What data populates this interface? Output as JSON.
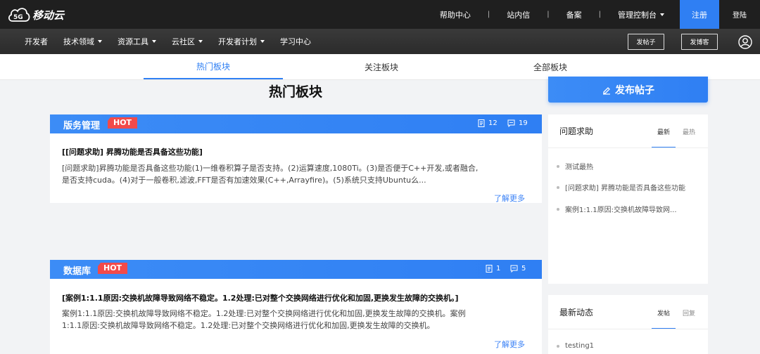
{
  "brand": {
    "logo_text": "移动云",
    "logo_badge": "5G"
  },
  "topnav": {
    "items": [
      "帮助中心",
      "站内信",
      "备案",
      "管理控制台"
    ],
    "separators": [
      "|",
      "|",
      "|"
    ],
    "register": "注册",
    "login": "登陆"
  },
  "secnav": {
    "links": [
      "开发者",
      "技术领域",
      "资源工具",
      "云社区",
      "开发者计划",
      "学习中心"
    ],
    "post_button": "发帖子",
    "blog_button": "发博客"
  },
  "tabs": [
    "热门板块",
    "关注板块",
    "全部板块"
  ],
  "page_title": "热门板块",
  "boards": [
    {
      "name": "版务管理",
      "badge": "HOT",
      "posts_count": "12",
      "comments_count": "19",
      "post_title": "[[问题求助] 昇腾功能是否具备这些功能]",
      "post_desc": "[问题求助]昇腾功能是否具备这些功能(1)一维卷积算子是否支持。(2)运算速度,1080Ti。(3)是否便于C++开发,或者融合,是否支持cuda。(4)对于一般卷积,滤波,FFT是否有加速效果(C++,Arrayfire)。(5)系统只支持Ubuntu么...",
      "more": "了解更多"
    },
    {
      "name": "数据库",
      "badge": "HOT",
      "posts_count": "1",
      "comments_count": "5",
      "post_title": "[案例1:1.1原因:交换机故障导致网络不稳定。1.2处理:已对整个交换网络进行优化和加固,更换发生故障的交换机。]",
      "post_desc": "案例1:1.1原因:交换机故障导致网络不稳定。1.2处理:已对整个交换网络进行优化和加固,更换发生故障的交换机。案例1:1.1原因:交换机故障导致网络不稳定。1.2处理:已对整个交换网络进行优化和加固,更换发生故障的交换机。",
      "more": "了解更多"
    }
  ],
  "sidebar": {
    "publish_label": "发布帖子",
    "help_panel": {
      "title": "问题求助",
      "tab_latest": "最新",
      "tab_hot": "最热",
      "items": [
        "测试最热",
        "[问题求助] 昇腾功能是否具备这些功能",
        "案例1:1.1原因:交换机故障导致网..."
      ]
    },
    "news_panel": {
      "title": "最新动态",
      "tab_posts": "发帖",
      "tab_replies": "回复",
      "items": [
        "testing1"
      ]
    }
  },
  "colors": {
    "accent": "#2f7ff3",
    "hot": "#f24a4a",
    "topbar": "#1f1f1f"
  }
}
